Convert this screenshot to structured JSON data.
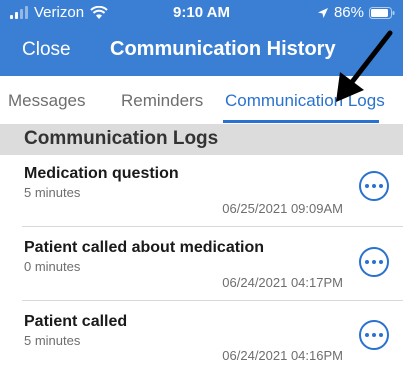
{
  "status_bar": {
    "carrier": "Verizon",
    "time": "9:10 AM",
    "battery": "86%",
    "icons": [
      "signal-icon",
      "wifi-icon",
      "location-arrow-icon",
      "battery-icon"
    ]
  },
  "nav_bar": {
    "close_label": "Close",
    "title": "Communication History"
  },
  "tabs": [
    {
      "label": "Messages",
      "selected": false
    },
    {
      "label": "Reminders",
      "selected": false
    },
    {
      "label": "Communication Logs",
      "selected": true
    }
  ],
  "section": {
    "header": "Communication Logs"
  },
  "logs": [
    {
      "title": "Medication question",
      "duration": "5 minutes",
      "date": "06/25/2021 09:09AM"
    },
    {
      "title": "Patient called about medication",
      "duration": "0 minutes",
      "date": "06/24/2021 04:17PM"
    },
    {
      "title": "Patient called",
      "duration": "5 minutes",
      "date": "06/24/2021 04:16PM"
    }
  ],
  "colors": {
    "header_blue": "#3b7fd4",
    "accent_blue": "#2a72cf",
    "section_gray": "#dcdcdc"
  }
}
